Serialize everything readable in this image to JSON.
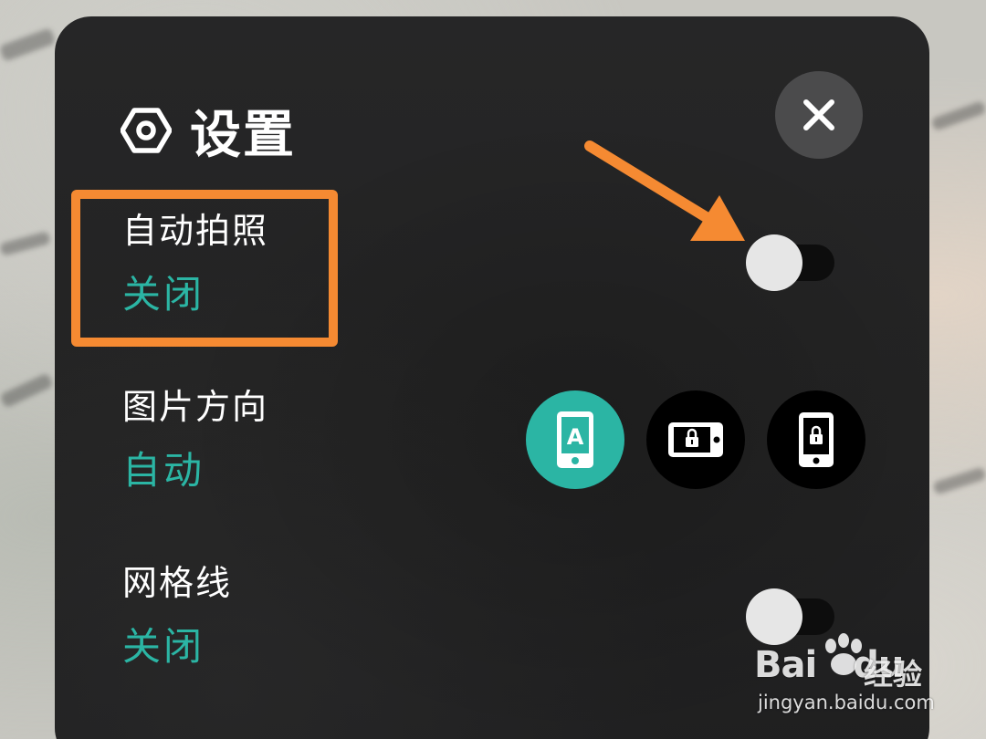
{
  "header": {
    "title": "设置",
    "settings_icon": "hexagon-gear-icon",
    "close_icon": "close-icon"
  },
  "settings": [
    {
      "label": "自动拍照",
      "value": "关闭",
      "control": "toggle",
      "on": false
    },
    {
      "label": "图片方向",
      "value": "自动",
      "control": "orientation-buttons",
      "options": [
        {
          "icon": "auto-rotate-phone-icon",
          "selected": true,
          "glyph": "A"
        },
        {
          "icon": "lock-landscape-icon",
          "selected": false
        },
        {
          "icon": "lock-portrait-icon",
          "selected": false
        }
      ]
    },
    {
      "label": "网格线",
      "value": "关闭",
      "control": "toggle",
      "on": false
    }
  ],
  "annotation": {
    "highlight_color": "#f58a32",
    "arrow_color": "#f58a32"
  },
  "watermark": {
    "brand": "Bai",
    "brand_suffix": "du",
    "product": "经验",
    "url": "jingyan.baidu.com"
  },
  "colors": {
    "accent": "#2bb5a4",
    "panel": "#242425",
    "close_button": "#4b4b4c",
    "text": "#ffffff"
  }
}
